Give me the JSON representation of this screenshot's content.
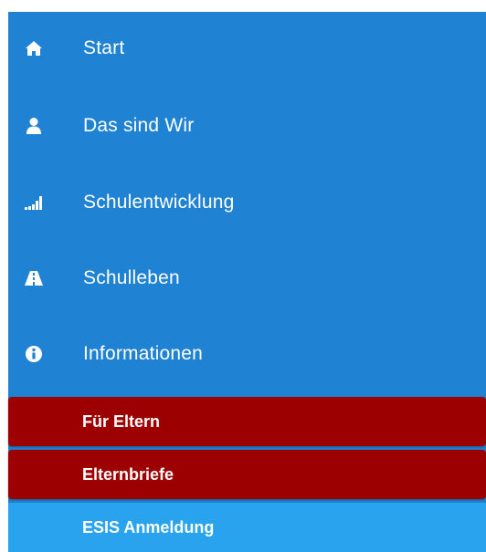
{
  "menu": {
    "items": [
      {
        "label": "Start",
        "icon": "home-icon"
      },
      {
        "label": "Das sind Wir",
        "icon": "user-icon"
      },
      {
        "label": "Schulentwicklung",
        "icon": "signal-bars-icon"
      },
      {
        "label": "Schulleben",
        "icon": "road-icon"
      },
      {
        "label": "Informationen",
        "icon": "info-circle-icon"
      }
    ],
    "subitems": [
      {
        "label": "Für Eltern",
        "state": "active"
      },
      {
        "label": "Elternbriefe",
        "state": "active"
      },
      {
        "label": "ESIS Anmeldung",
        "state": "normal"
      }
    ]
  },
  "colors": {
    "menu_bg": "#1f82d2",
    "active_bg": "#9c0000",
    "subitem_bg": "#2aa3ee",
    "text": "#ffffff"
  }
}
